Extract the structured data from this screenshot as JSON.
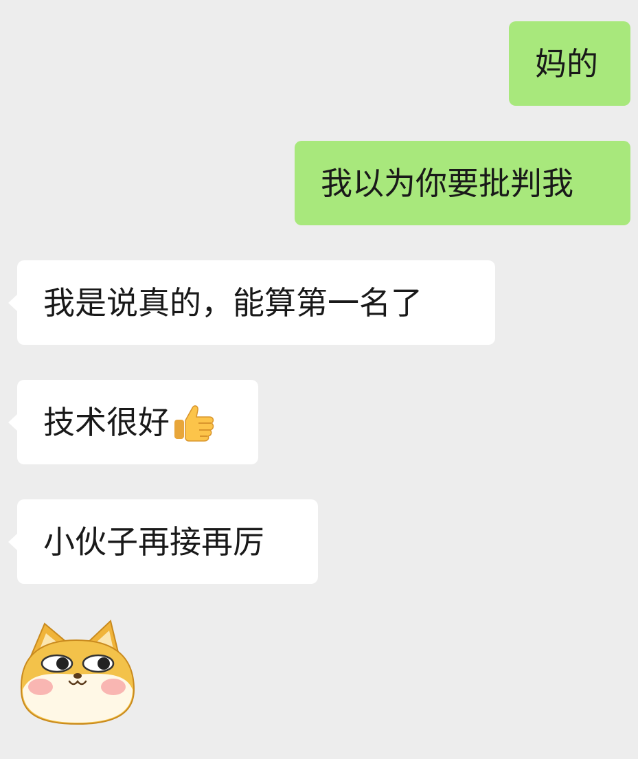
{
  "messages": [
    {
      "direction": "sent",
      "text": "妈的"
    },
    {
      "direction": "sent",
      "text": "我以为你要批判我"
    },
    {
      "direction": "received",
      "text": "我是说真的，能算第一名了"
    },
    {
      "direction": "received",
      "text": "技术很好",
      "emoji": "thumbs-up-icon"
    },
    {
      "direction": "received",
      "text": "小伙子再接再厉"
    },
    {
      "direction": "received",
      "sticker": "shiba-doge-sticker"
    }
  ],
  "colors": {
    "background": "#ededed",
    "sent_bubble": "#a8e87c",
    "received_bubble": "#ffffff",
    "text": "#191919"
  }
}
